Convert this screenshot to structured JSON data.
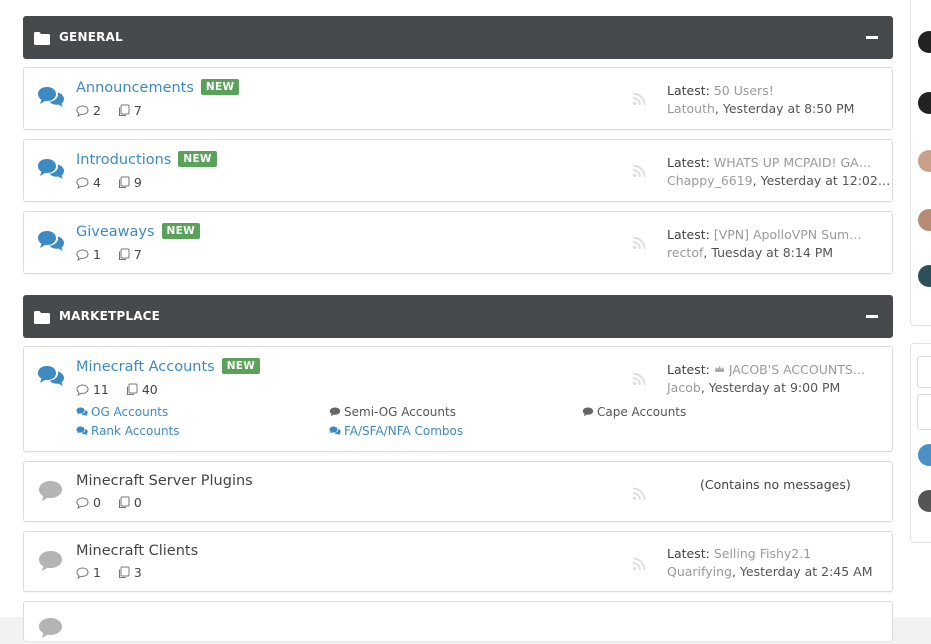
{
  "categories": [
    {
      "title": "GENERAL"
    },
    {
      "title": "MARKETPLACE"
    }
  ],
  "forums": [
    {
      "title": "Announcements",
      "badge": "NEW",
      "threads": "2",
      "messages": "7",
      "latest_label": "Latest:",
      "latest_thread": "50 Users!",
      "latest_user": "Latouth",
      "latest_sep": ",",
      "latest_time": "Yesterday at 8:50 PM"
    },
    {
      "title": "Introductions",
      "badge": "NEW",
      "threads": "4",
      "messages": "9",
      "latest_label": "Latest:",
      "latest_thread": "WHATS UP MCPAID! GAN…",
      "latest_user": "Chappy_6619",
      "latest_sep": ",",
      "latest_time": "Yesterday at 12:02…"
    },
    {
      "title": "Giveaways",
      "badge": "NEW",
      "threads": "1",
      "messages": "7",
      "latest_label": "Latest:",
      "latest_thread": "[VPN] ApolloVPN Summe…",
      "latest_user": "rectof",
      "latest_sep": ",",
      "latest_time": "Tuesday at 8:14 PM"
    },
    {
      "title": "Minecraft Accounts",
      "badge": "NEW",
      "threads": "11",
      "messages": "40",
      "latest_label": "Latest:",
      "latest_thread": "JACOB'S ACCOUNTS! …",
      "latest_user": "Jacob",
      "latest_sep": ",",
      "latest_time": "Yesterday at 9:00 PM",
      "subforums": [
        "OG Accounts",
        "Semi-OG Accounts",
        "Cape Accounts",
        "Rank Accounts",
        "FA/SFA/NFA Combos"
      ]
    },
    {
      "title": "Minecraft Server Plugins",
      "threads": "0",
      "messages": "0",
      "no_messages": "(Contains no messages)"
    },
    {
      "title": "Minecraft Clients",
      "threads": "1",
      "messages": "3",
      "latest_label": "Latest:",
      "latest_thread": "Selling Fishy2.1",
      "latest_user": "Quarifying",
      "latest_sep": ",",
      "latest_time": "Yesterday at 2:45 AM"
    }
  ],
  "colors": {
    "category_bar": "#474a4d",
    "link_blue": "#3d8ac2",
    "badge_green": "#5aa15a",
    "muted_grey": "#9a9a9a"
  },
  "icons": {
    "category": "folder-icon",
    "forum_unread": "chat-bubbles-blue-icon",
    "forum_read": "chat-bubble-grey-icon",
    "threads": "comment-icon",
    "messages": "copy-icon",
    "rss": "rss-icon",
    "collapse": "minus-icon"
  }
}
